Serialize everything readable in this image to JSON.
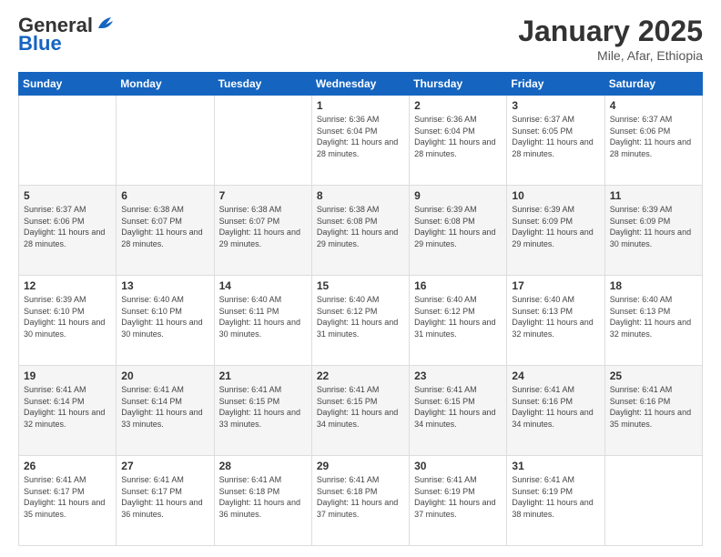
{
  "header": {
    "logo_general": "General",
    "logo_blue": "Blue",
    "title": "January 2025",
    "location": "Mile, Afar, Ethiopia"
  },
  "days_of_week": [
    "Sunday",
    "Monday",
    "Tuesday",
    "Wednesday",
    "Thursday",
    "Friday",
    "Saturday"
  ],
  "weeks": [
    [
      {
        "day": "",
        "info": ""
      },
      {
        "day": "",
        "info": ""
      },
      {
        "day": "",
        "info": ""
      },
      {
        "day": "1",
        "info": "Sunrise: 6:36 AM\nSunset: 6:04 PM\nDaylight: 11 hours and 28 minutes."
      },
      {
        "day": "2",
        "info": "Sunrise: 6:36 AM\nSunset: 6:04 PM\nDaylight: 11 hours and 28 minutes."
      },
      {
        "day": "3",
        "info": "Sunrise: 6:37 AM\nSunset: 6:05 PM\nDaylight: 11 hours and 28 minutes."
      },
      {
        "day": "4",
        "info": "Sunrise: 6:37 AM\nSunset: 6:06 PM\nDaylight: 11 hours and 28 minutes."
      }
    ],
    [
      {
        "day": "5",
        "info": "Sunrise: 6:37 AM\nSunset: 6:06 PM\nDaylight: 11 hours and 28 minutes."
      },
      {
        "day": "6",
        "info": "Sunrise: 6:38 AM\nSunset: 6:07 PM\nDaylight: 11 hours and 28 minutes."
      },
      {
        "day": "7",
        "info": "Sunrise: 6:38 AM\nSunset: 6:07 PM\nDaylight: 11 hours and 29 minutes."
      },
      {
        "day": "8",
        "info": "Sunrise: 6:38 AM\nSunset: 6:08 PM\nDaylight: 11 hours and 29 minutes."
      },
      {
        "day": "9",
        "info": "Sunrise: 6:39 AM\nSunset: 6:08 PM\nDaylight: 11 hours and 29 minutes."
      },
      {
        "day": "10",
        "info": "Sunrise: 6:39 AM\nSunset: 6:09 PM\nDaylight: 11 hours and 29 minutes."
      },
      {
        "day": "11",
        "info": "Sunrise: 6:39 AM\nSunset: 6:09 PM\nDaylight: 11 hours and 30 minutes."
      }
    ],
    [
      {
        "day": "12",
        "info": "Sunrise: 6:39 AM\nSunset: 6:10 PM\nDaylight: 11 hours and 30 minutes."
      },
      {
        "day": "13",
        "info": "Sunrise: 6:40 AM\nSunset: 6:10 PM\nDaylight: 11 hours and 30 minutes."
      },
      {
        "day": "14",
        "info": "Sunrise: 6:40 AM\nSunset: 6:11 PM\nDaylight: 11 hours and 30 minutes."
      },
      {
        "day": "15",
        "info": "Sunrise: 6:40 AM\nSunset: 6:12 PM\nDaylight: 11 hours and 31 minutes."
      },
      {
        "day": "16",
        "info": "Sunrise: 6:40 AM\nSunset: 6:12 PM\nDaylight: 11 hours and 31 minutes."
      },
      {
        "day": "17",
        "info": "Sunrise: 6:40 AM\nSunset: 6:13 PM\nDaylight: 11 hours and 32 minutes."
      },
      {
        "day": "18",
        "info": "Sunrise: 6:40 AM\nSunset: 6:13 PM\nDaylight: 11 hours and 32 minutes."
      }
    ],
    [
      {
        "day": "19",
        "info": "Sunrise: 6:41 AM\nSunset: 6:14 PM\nDaylight: 11 hours and 32 minutes."
      },
      {
        "day": "20",
        "info": "Sunrise: 6:41 AM\nSunset: 6:14 PM\nDaylight: 11 hours and 33 minutes."
      },
      {
        "day": "21",
        "info": "Sunrise: 6:41 AM\nSunset: 6:15 PM\nDaylight: 11 hours and 33 minutes."
      },
      {
        "day": "22",
        "info": "Sunrise: 6:41 AM\nSunset: 6:15 PM\nDaylight: 11 hours and 34 minutes."
      },
      {
        "day": "23",
        "info": "Sunrise: 6:41 AM\nSunset: 6:15 PM\nDaylight: 11 hours and 34 minutes."
      },
      {
        "day": "24",
        "info": "Sunrise: 6:41 AM\nSunset: 6:16 PM\nDaylight: 11 hours and 34 minutes."
      },
      {
        "day": "25",
        "info": "Sunrise: 6:41 AM\nSunset: 6:16 PM\nDaylight: 11 hours and 35 minutes."
      }
    ],
    [
      {
        "day": "26",
        "info": "Sunrise: 6:41 AM\nSunset: 6:17 PM\nDaylight: 11 hours and 35 minutes."
      },
      {
        "day": "27",
        "info": "Sunrise: 6:41 AM\nSunset: 6:17 PM\nDaylight: 11 hours and 36 minutes."
      },
      {
        "day": "28",
        "info": "Sunrise: 6:41 AM\nSunset: 6:18 PM\nDaylight: 11 hours and 36 minutes."
      },
      {
        "day": "29",
        "info": "Sunrise: 6:41 AM\nSunset: 6:18 PM\nDaylight: 11 hours and 37 minutes."
      },
      {
        "day": "30",
        "info": "Sunrise: 6:41 AM\nSunset: 6:19 PM\nDaylight: 11 hours and 37 minutes."
      },
      {
        "day": "31",
        "info": "Sunrise: 6:41 AM\nSunset: 6:19 PM\nDaylight: 11 hours and 38 minutes."
      },
      {
        "day": "",
        "info": ""
      }
    ]
  ]
}
